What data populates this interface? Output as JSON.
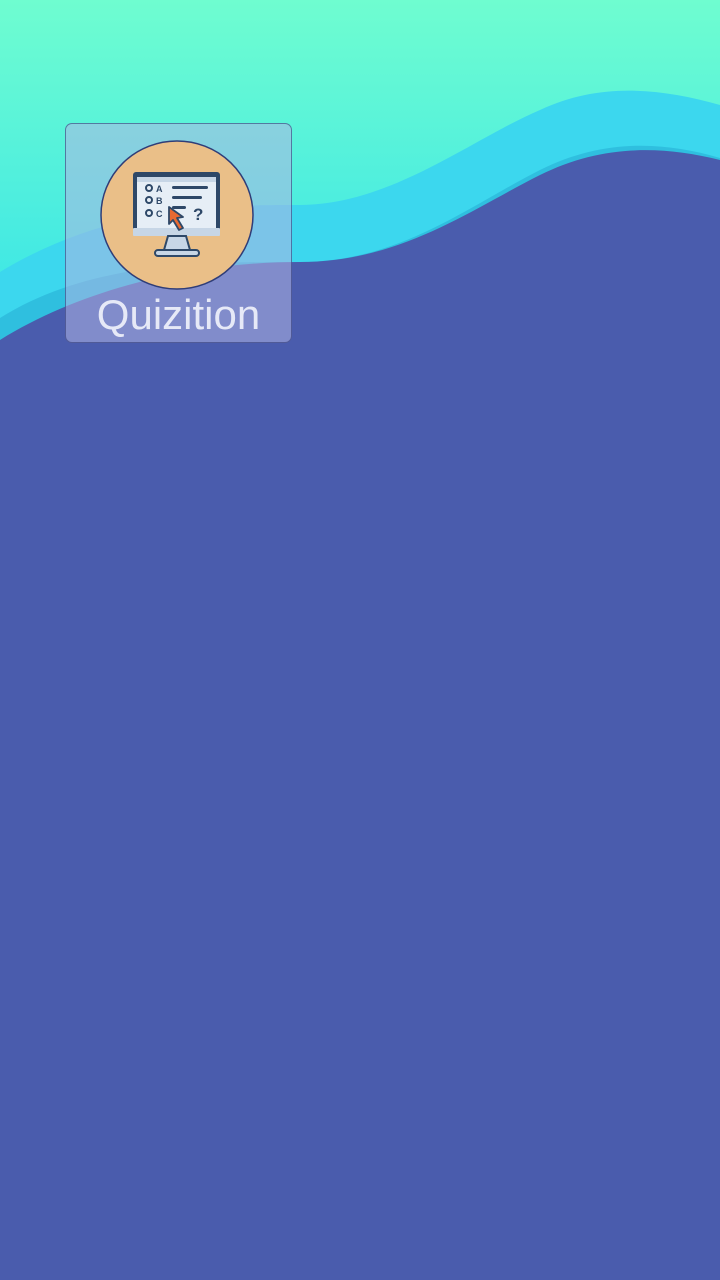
{
  "background": {
    "gradient_top": "#6ffdd0",
    "gradient_bottom": "#33e2ea",
    "wave_light": "#3cd7ee",
    "wave_mid": "#2bb7da",
    "main_color": "#4a5cad"
  },
  "app": {
    "label": "Quizition",
    "icon": "quiz-monitor-icon",
    "icon_circle_color": "#eabf88",
    "choices": [
      "A",
      "B",
      "C"
    ],
    "question_mark": "?"
  }
}
